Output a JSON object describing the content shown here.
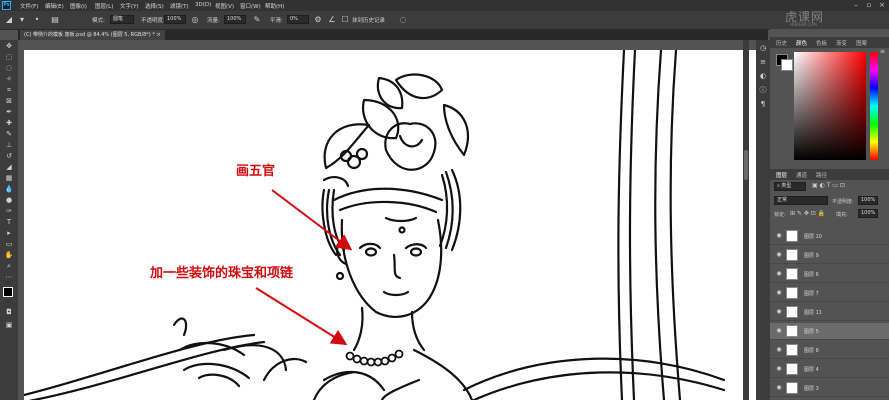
{
  "menubar": {
    "logo": "Ps",
    "items": [
      "文件(F)",
      "编辑(E)",
      "图像(I)",
      "图层(L)",
      "文字(Y)",
      "选择(S)",
      "滤镜(T)",
      "3D(D)",
      "视图(V)",
      "窗口(W)",
      "帮助(H)"
    ]
  },
  "options": {
    "mode_label": "模式:",
    "mode_value": "圆笔",
    "opacity_label": "不透明度:",
    "opacity_value": "100%",
    "flow_label": "流量:",
    "flow_value": "100%",
    "smooth_label": "平滑:",
    "smooth_value": "0%",
    "history_label": "抹到历史记录"
  },
  "document_tab": {
    "title": "(C) 带侧介的模板 轰板.psd @ 84.4% (图层 5, RGB/8*) *"
  },
  "annotations": [
    {
      "text": "画五官"
    },
    {
      "text": "加一些装饰的珠宝和项链"
    }
  ],
  "panels": {
    "top_tabs": [
      "历史",
      "颜色",
      "色板",
      "渐变",
      "图案"
    ],
    "layer_tabs": [
      "图层",
      "通道",
      "路径"
    ],
    "kind_label": "类型",
    "blend_mode": "正常",
    "opacity_label": "不透明度:",
    "opacity_value": "100%",
    "lock_label": "锁定:",
    "fill_label": "填充:",
    "fill_value": "100%"
  },
  "layers": [
    {
      "name": "图层 10",
      "selected": false
    },
    {
      "name": "图层 9",
      "selected": false
    },
    {
      "name": "图层 6",
      "selected": false
    },
    {
      "name": "图层 7",
      "selected": false
    },
    {
      "name": "图层 11",
      "selected": false
    },
    {
      "name": "图层 5",
      "selected": true
    },
    {
      "name": "图层 8",
      "selected": false
    },
    {
      "name": "图层 4",
      "selected": false
    },
    {
      "name": "图层 3",
      "selected": false
    }
  ],
  "watermark": {
    "text": "虎课网",
    "sub": "HUKE88.COM"
  },
  "colors": {
    "accent": "#31a8ff",
    "annotation": "#d10a10",
    "foreground": "#000000",
    "background": "#ffffff"
  }
}
